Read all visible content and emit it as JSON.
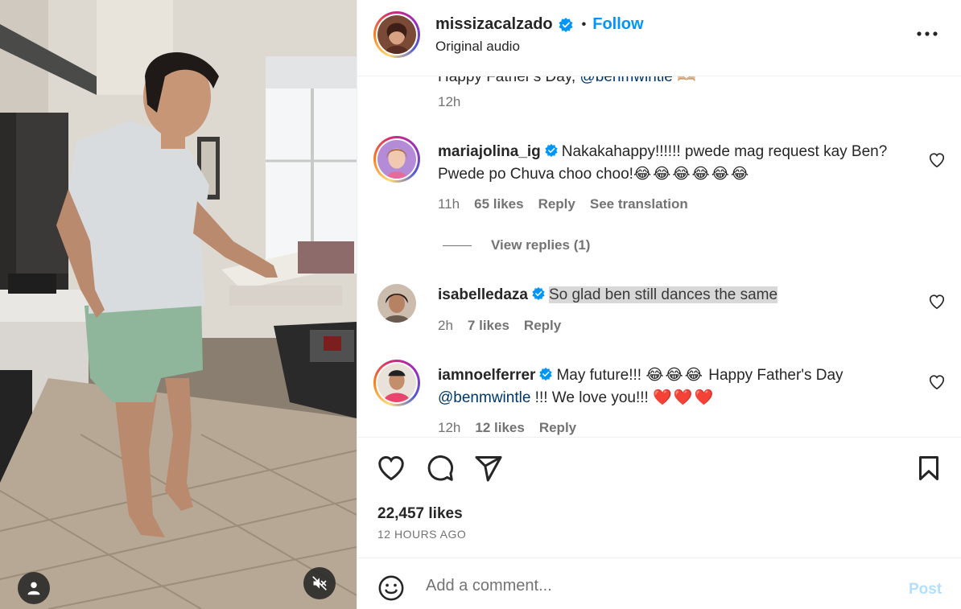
{
  "post": {
    "username": "missizacalzado",
    "separator": "•",
    "follow_label": "Follow",
    "audio": "Original audio",
    "likes": "22,457 likes",
    "time_ago": "12 HOURS AGO"
  },
  "caption": {
    "text": "Happy Father's Day, ",
    "mention": "@benmwintle",
    "emoji": "🫶🏼",
    "time": "12h"
  },
  "comments": [
    {
      "username": "mariajolina_ig",
      "text": "Nakakahappy!!!!!! pwede mag request kay Ben? Pwede po Chuva choo choo!",
      "emoji": "😂😂😂😂😂😂",
      "time": "11h",
      "likes": "65 likes",
      "reply": "Reply",
      "see_translation": "See translation",
      "view_replies": "View replies (1)"
    },
    {
      "username": "isabelledaza",
      "text": "So glad ben still dances the same",
      "time": "2h",
      "likes": "7 likes",
      "reply": "Reply"
    },
    {
      "username": "iamnoelferrer",
      "text_before": "May future!!! ",
      "emoji1": "😂😂😂",
      "text_mid": " Happy Father's Day ",
      "mention": "@benmwintle",
      "text_after": " !!! We love you!!! ",
      "emoji2": "❤️❤️❤️",
      "time": "12h",
      "likes": "12 likes",
      "reply": "Reply"
    }
  ],
  "comment_box": {
    "placeholder": "Add a comment...",
    "post_label": "Post"
  },
  "icons": {
    "verified": "verified-badge-icon",
    "more": "more-options-icon",
    "like": "heart-icon",
    "comment": "comment-icon",
    "share": "share-icon",
    "save": "bookmark-icon",
    "emoji": "emoji-icon",
    "mute": "mute-icon",
    "user_tag": "user-tag-icon"
  },
  "colors": {
    "accent": "#0095f6",
    "post_disabled": "#b2dffc",
    "secondary_text": "#737373",
    "mention": "#00376b",
    "heart_red": "#e0245e"
  }
}
